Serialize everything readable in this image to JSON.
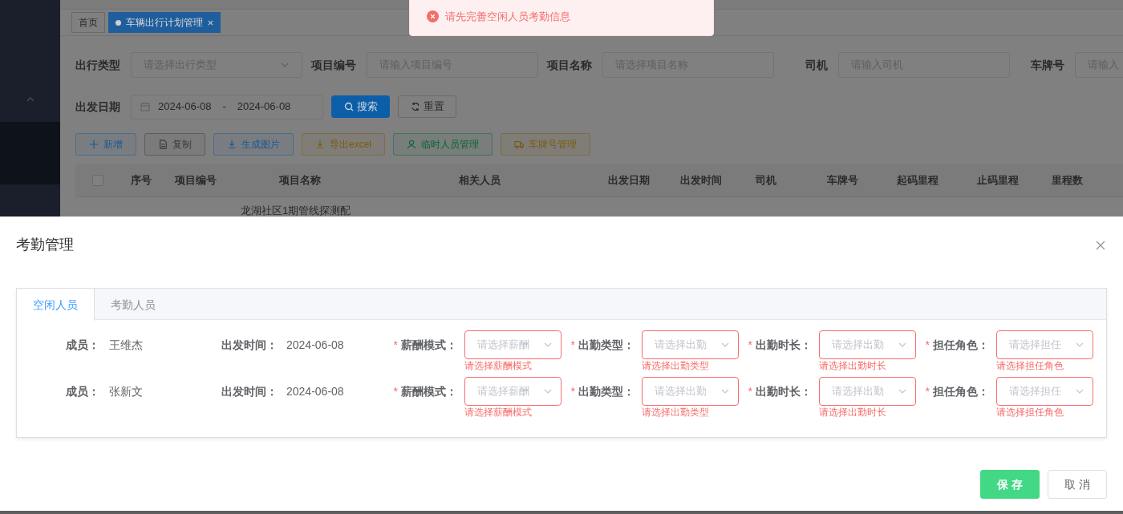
{
  "toast": {
    "kind": "error",
    "message": "请先完善空闲人员考勤信息"
  },
  "page_tabs": [
    {
      "label": "首页",
      "selected": false,
      "closable": false
    },
    {
      "label": "车辆出行计划管理",
      "selected": true,
      "closable": true
    }
  ],
  "filters": [
    {
      "label": "出行类型",
      "kind": "select",
      "placeholder": "请选择出行类型"
    },
    {
      "label": "项目编号",
      "kind": "input",
      "placeholder": "请输入项目编号"
    },
    {
      "label": "项目名称",
      "kind": "input",
      "placeholder": "请选择项目名称"
    },
    {
      "label": "司机",
      "kind": "input",
      "placeholder": "请输入司机"
    },
    {
      "label": "车牌号",
      "kind": "input",
      "placeholder": "请输入"
    }
  ],
  "date_filter": {
    "label": "出发日期",
    "start": "2024-06-08",
    "separator": "-",
    "end": "2024-06-08"
  },
  "filter_buttons": [
    {
      "label": "搜索",
      "kind": "primary"
    },
    {
      "label": "重置",
      "kind": "default"
    }
  ],
  "toolbar": [
    {
      "label": "新增",
      "color": "#1a5794"
    },
    {
      "label": "复制",
      "color": "#3a3a3a"
    },
    {
      "label": "生成图片",
      "color": "#1a5794"
    },
    {
      "label": "导出excel",
      "color": "#7a5a0c"
    },
    {
      "label": "临时人员管理",
      "color": "#0c6233"
    },
    {
      "label": "车牌号管理",
      "color": "#7a5a0c"
    }
  ],
  "table": {
    "header_checkbox": {
      "checked": false
    },
    "columns": [
      "序号",
      "项目编号",
      "项目名称",
      "相关人员",
      "出发日期",
      "出发时间",
      "司机",
      "车牌号",
      "起码里程",
      "止码里程",
      "里程数"
    ],
    "rows": [
      {
        "project_name": "龙湖社区1期管线探测配"
      }
    ]
  },
  "dialog": {
    "title": "考勤管理",
    "required_mark": "*",
    "tabs": [
      {
        "label": "空闲人员",
        "selected": true
      },
      {
        "label": "考勤人员",
        "selected": false
      }
    ],
    "rows": [
      {
        "member_label": "成员：",
        "member": "王维杰",
        "date_label": "出发时间：",
        "date": "2024-06-08",
        "fields": [
          {
            "label": "薪酬模式：",
            "required": true,
            "placeholder": "请选择薪酬",
            "error": "请选择薪酬模式"
          },
          {
            "label": "出勤类型：",
            "required": true,
            "placeholder": "请选择出勤",
            "error": "请选择出勤类型"
          },
          {
            "label": "出勤时长：",
            "required": true,
            "placeholder": "请选择出勤",
            "error": "请选择出勤时长"
          },
          {
            "label": "担任角色：",
            "required": true,
            "placeholder": "请选择担任",
            "error": "请选择担任角色"
          }
        ]
      },
      {
        "member_label": "成员：",
        "member": "张新文",
        "date_label": "出发时间：",
        "date": "2024-06-08",
        "fields": [
          {
            "label": "薪酬模式：",
            "required": true,
            "placeholder": "请选择薪酬",
            "error": "请选择薪酬模式"
          },
          {
            "label": "出勤类型：",
            "required": true,
            "placeholder": "请选择出勤",
            "error": "请选择出勤类型"
          },
          {
            "label": "出勤时长：",
            "required": true,
            "placeholder": "请选择出勤",
            "error": "请选择出勤时长"
          },
          {
            "label": "担任角色：",
            "required": true,
            "placeholder": "请选择担任",
            "error": "请选择担任角色"
          }
        ]
      }
    ],
    "buttons": [
      {
        "label": "保 存",
        "kind": "primary"
      },
      {
        "label": "取 消",
        "kind": "default"
      }
    ]
  }
}
